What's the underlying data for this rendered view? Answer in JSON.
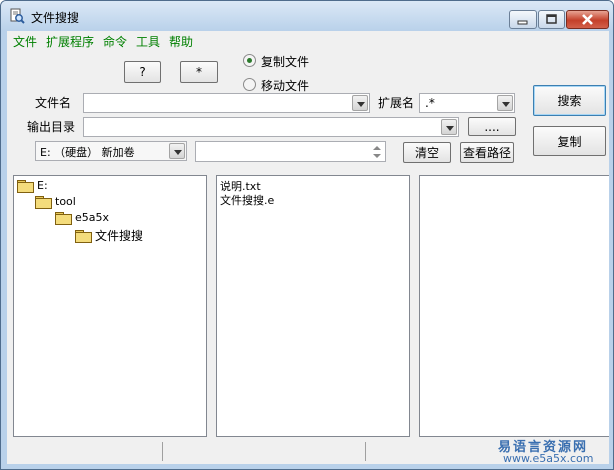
{
  "window": {
    "title": "文件搜搜"
  },
  "menu": [
    "文件",
    "扩展程序",
    "命令",
    "工具",
    "帮助"
  ],
  "buttons": {
    "question": "?",
    "star": "*",
    "search": "搜索",
    "copy": "复制",
    "browse": "....",
    "clear": "清空",
    "view_path": "查看路径"
  },
  "mode": {
    "copy_label": "复制文件",
    "move_label": "移动文件",
    "selected": "复制文件"
  },
  "filename": {
    "label": "文件名",
    "value": ""
  },
  "extension": {
    "label": "扩展名",
    "value": ".*"
  },
  "output_dir": {
    "label": "输出目录",
    "value": ""
  },
  "drive": {
    "value": "E: （硬盘） 新加卷"
  },
  "spin_value": "",
  "tree": [
    {
      "label": "E:",
      "level": 0
    },
    {
      "label": "tool",
      "level": 1
    },
    {
      "label": "e5a5x",
      "level": 2
    },
    {
      "label": "文件搜搜",
      "level": 3,
      "selected": true
    }
  ],
  "files": [
    "说明.txt",
    "文件搜搜.e"
  ],
  "watermark": {
    "line1": "易语言资源网",
    "line2": "www.e5a5x.com"
  },
  "colors": {
    "menu_text": "#008000",
    "titlebar": "#b9d1ea",
    "close_button": "#c4402a"
  }
}
